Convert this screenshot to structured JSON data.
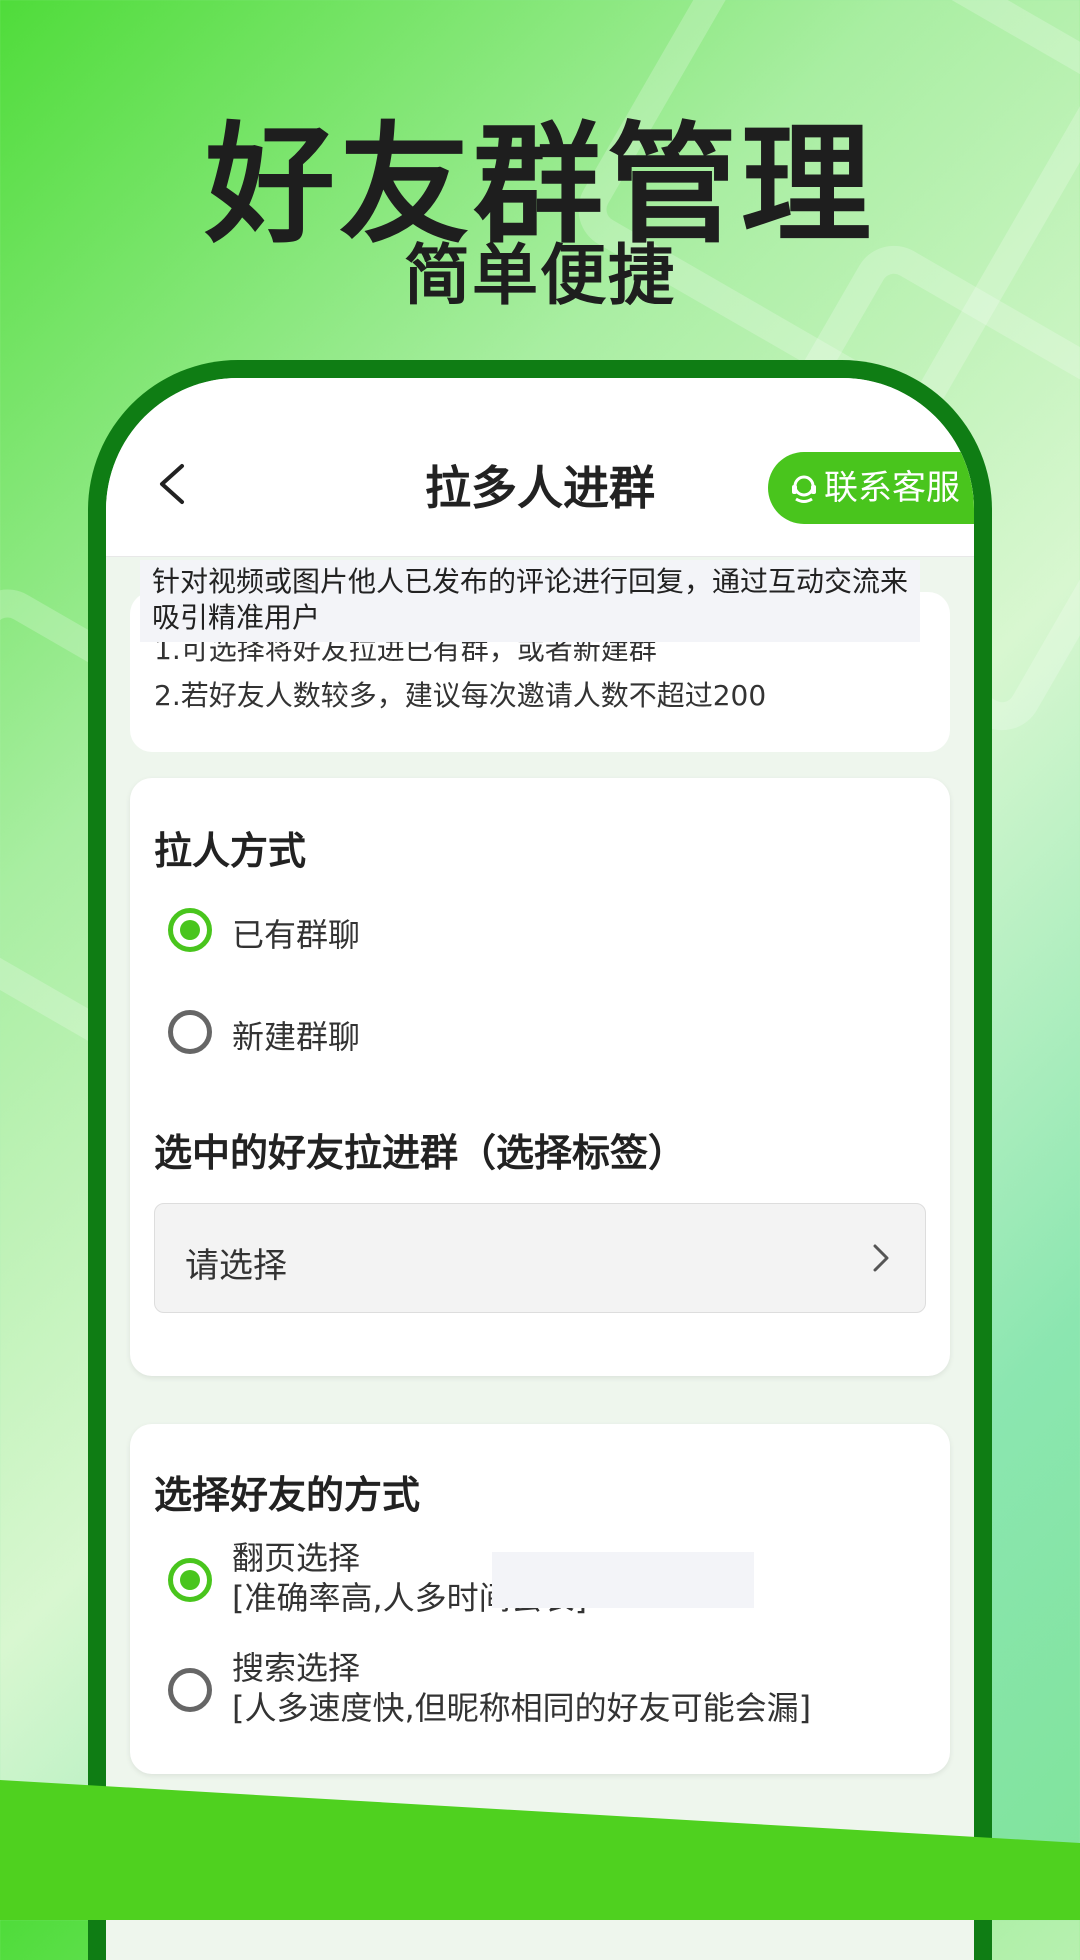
{
  "hero": {
    "title": "好友群管理",
    "subtitle": "简单便捷"
  },
  "nav": {
    "back_icon": "chevron-left-icon",
    "title": "拉多人进群",
    "support_label": "联系客服",
    "support_icon": "headset-icon"
  },
  "notice": {
    "overlay": "针对视频或图片他人已发布的评论进行回复，通过互动交流来吸引精准用户",
    "line1": "1.可选择将好友拉进已有群，或者新建群",
    "line2": "2.若好友人数较多，建议每次邀请人数不超过200"
  },
  "pull_method": {
    "title": "拉人方式",
    "options": [
      {
        "label": "已有群聊",
        "selected": true
      },
      {
        "label": "新建群聊",
        "selected": false
      }
    ],
    "tag_title": "选中的好友拉进群（选择标签）",
    "select_placeholder": "请选择"
  },
  "friend_method": {
    "title": "选择好友的方式",
    "options": [
      {
        "label": "翻页选择",
        "desc": "[准确率高,人多时间会长]",
        "selected": true
      },
      {
        "label": "搜索选择",
        "desc": "[人多速度快,但昵称相同的好友可能会漏]",
        "selected": false
      }
    ]
  },
  "colors": {
    "accent": "#49c51d",
    "phone_frame": "#0f7d14"
  }
}
